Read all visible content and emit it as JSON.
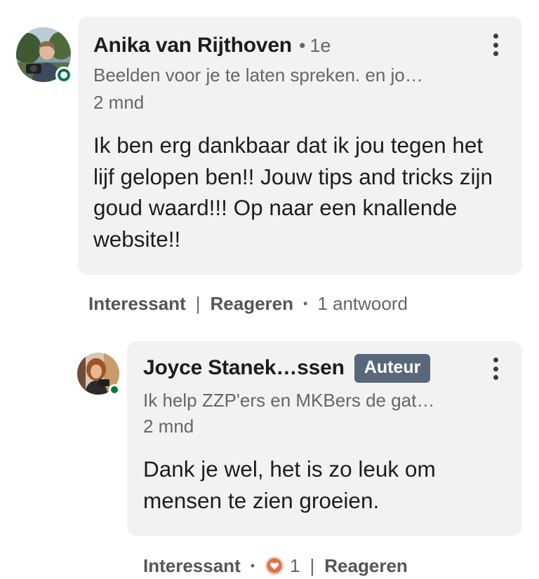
{
  "comment": {
    "author": "Anika van Rijthoven",
    "degree": "1e",
    "headline": "Beelden voor je te laten spreken. en jo…",
    "time": "2 mnd",
    "body": "Ik ben erg dankbaar dat ik jou tegen het lijf gelopen ben!! Jouw tips and tricks zijn goud waard!!! Op naar een knallende website!!",
    "actions": {
      "like_label": "Interessant",
      "reply_label": "Reageren",
      "replies_count": "1 antwoord"
    }
  },
  "reply": {
    "author": "Joyce Stanek…ssen",
    "badge": "Auteur",
    "headline": "Ik help ZZP'ers en MKBers de gat…",
    "time": "2 mnd",
    "body": "Dank je wel, het is zo leuk om mensen te zien groeien.",
    "actions": {
      "like_label": "Interessant",
      "reaction_count": "1",
      "reaction_icon": "heart-reaction-icon",
      "reply_label": "Reageren"
    }
  },
  "colors": {
    "bubble": "#f2f2f2",
    "badge": "#56687a",
    "presence": "#057642",
    "reaction": "#df704d"
  }
}
